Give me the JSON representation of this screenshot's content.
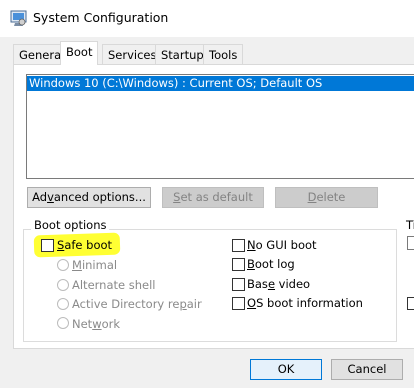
{
  "window": {
    "title": "System Configuration"
  },
  "tabs": [
    {
      "label": "General"
    },
    {
      "label": "Boot",
      "active": true
    },
    {
      "label": "Services"
    },
    {
      "label": "Startup"
    },
    {
      "label": "Tools"
    }
  ],
  "os_list": {
    "items": [
      "Windows 10 (C:\\Windows) : Current OS; Default OS"
    ],
    "selected_index": 0
  },
  "buttons": {
    "advanced_options": {
      "label": "Advanced options...",
      "enabled": true
    },
    "set_default": {
      "label": "Set as default",
      "enabled": false
    },
    "delete": {
      "label": "Delete",
      "enabled": false
    }
  },
  "boot_options": {
    "group_label": "Boot options",
    "safe_boot": {
      "label": "Safe boot",
      "checked": false
    },
    "safe_boot_modes": [
      {
        "label": "Minimal",
        "enabled": false
      },
      {
        "label": "Alternate shell",
        "enabled": false
      },
      {
        "label": "Active Directory repair",
        "enabled": false
      },
      {
        "label": "Network",
        "enabled": false
      }
    ],
    "no_gui_boot": {
      "label": "No GUI boot",
      "checked": false
    },
    "boot_log": {
      "label": "Boot log",
      "checked": false
    },
    "base_video": {
      "label": "Base video",
      "checked": false
    },
    "os_boot_information": {
      "label": "OS boot information",
      "checked": false
    }
  },
  "timeout_partial": {
    "label": "Ti"
  },
  "dialog_buttons": {
    "ok": "OK",
    "cancel": "Cancel"
  },
  "colors": {
    "selection": "#0078d7",
    "highlight": "#ffff33"
  }
}
